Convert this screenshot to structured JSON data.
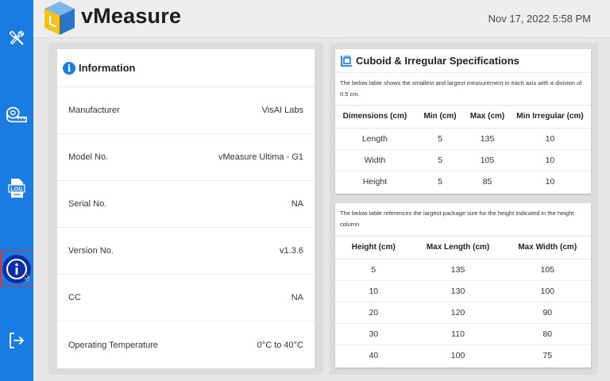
{
  "header": {
    "app_name": "vMeasure",
    "datetime": "Nov 17, 2022 5:58 PM"
  },
  "sidebar": {
    "items": [
      {
        "icon": "tools-icon",
        "label": "Tools"
      },
      {
        "icon": "measuring-tape-icon",
        "label": "Measure"
      },
      {
        "icon": "log-icon",
        "label": "LOG"
      },
      {
        "icon": "info-icon",
        "label": "Info",
        "active": true
      },
      {
        "icon": "logout-icon",
        "label": "Logout"
      }
    ],
    "log_text": "LOG"
  },
  "information": {
    "title": "Information",
    "rows": [
      {
        "label": "Manufacturer",
        "value": "VisAI Labs"
      },
      {
        "label": "Model No.",
        "value": "vMeasure Ultima - G1"
      },
      {
        "label": "Serial No.",
        "value": "NA"
      },
      {
        "label": "Version No.",
        "value": "v1.3.6"
      },
      {
        "label": "CC",
        "value": "NA"
      },
      {
        "label": "Operating Temperature",
        "value": "0°C to 40°C"
      }
    ]
  },
  "specs": {
    "title": "Cuboid & Irregular Specifications",
    "description": "The below table shows the smallest and largest measurement in each axis with a division of 0.5 cm.",
    "headers": [
      "Dimensions (cm)",
      "Min (cm)",
      "Max (cm)",
      "Min Irregular (cm)"
    ],
    "rows": [
      [
        "Length",
        "5",
        "135",
        "10"
      ],
      [
        "Width",
        "5",
        "105",
        "10"
      ],
      [
        "Height",
        "5",
        "85",
        "10"
      ]
    ]
  },
  "max_size": {
    "description": "The below table references the largest package size for the height indicated in the height column",
    "headers": [
      "Height (cm)",
      "Max Length (cm)",
      "Max Width (cm)"
    ],
    "rows": [
      [
        "5",
        "135",
        "105"
      ],
      [
        "10",
        "130",
        "100"
      ],
      [
        "20",
        "120",
        "90"
      ],
      [
        "30",
        "110",
        "80"
      ],
      [
        "40",
        "100",
        "75"
      ]
    ]
  },
  "colors": {
    "sidebar": "#1a7be0",
    "active": "#0a2fa8",
    "logo_top": "#7ab6e8",
    "logo_side": "#f2c31b"
  }
}
